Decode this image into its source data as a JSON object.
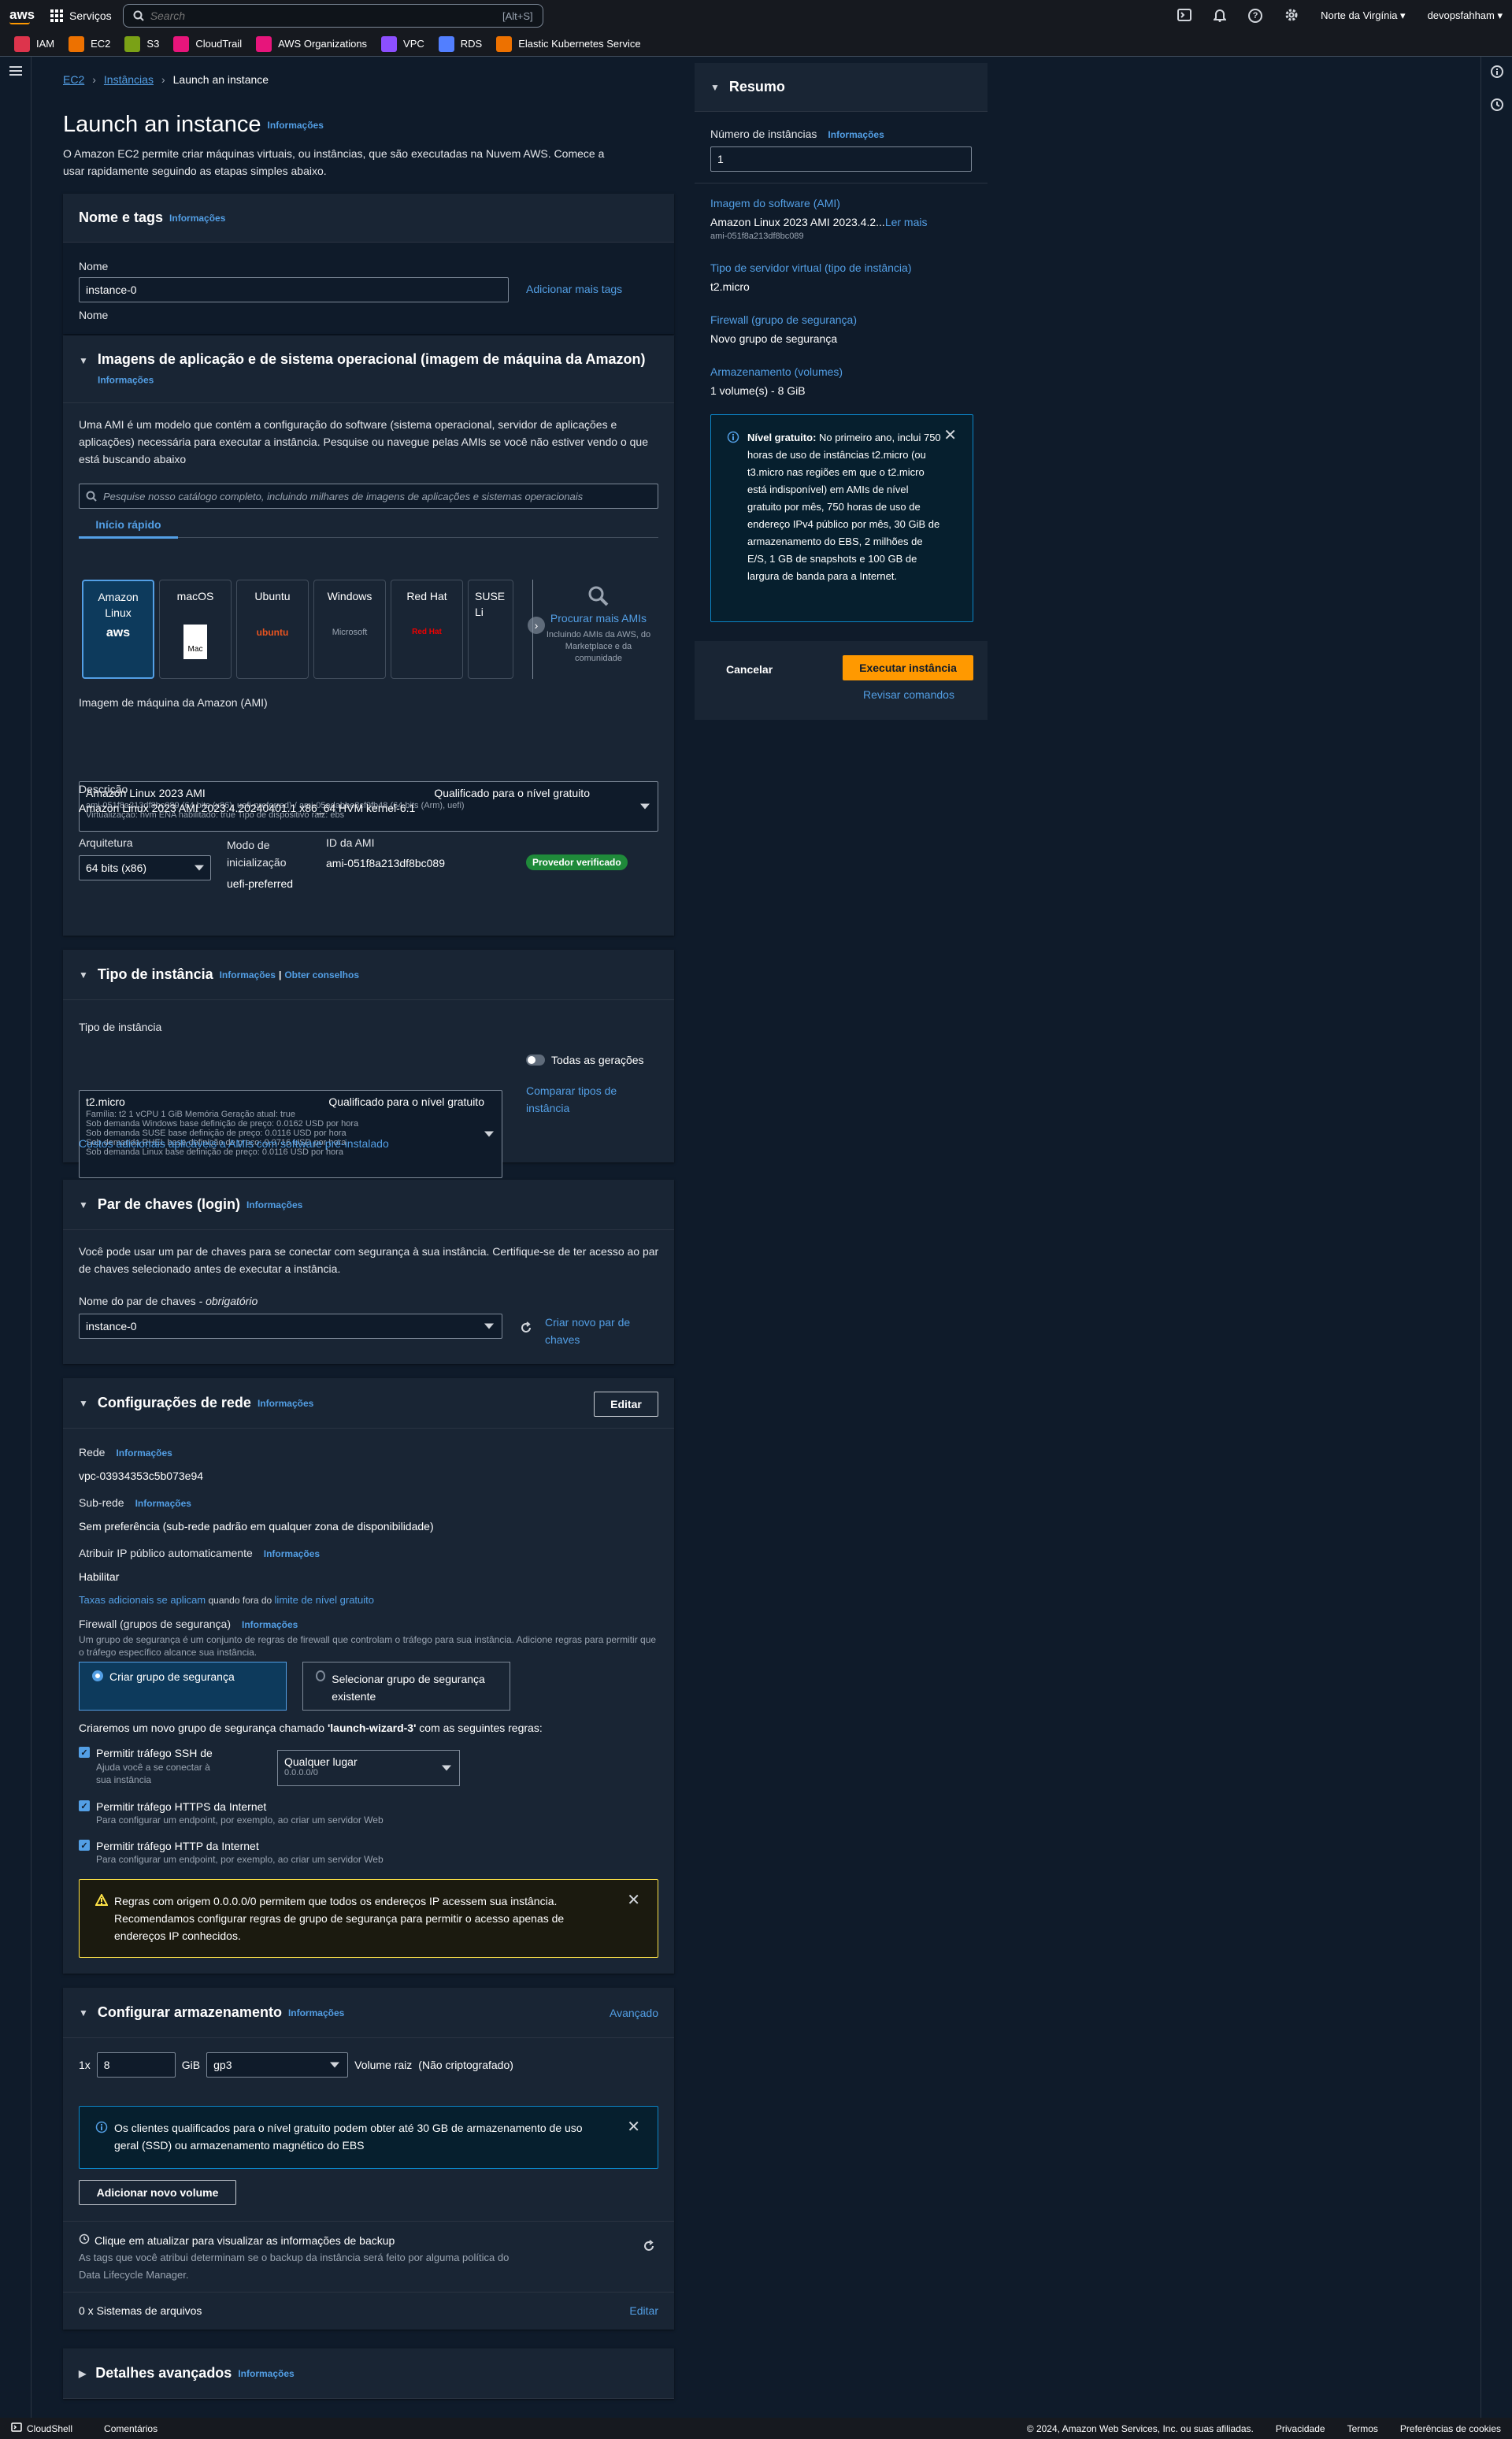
{
  "topnav": {
    "logo": "aws",
    "services_label": "Serviços",
    "search_placeholder": "Search",
    "search_shortcut": "[Alt+S]",
    "region": "Norte da Virgínia ▾",
    "user": "devopsfahham ▾"
  },
  "favorites": [
    {
      "label": "IAM",
      "color": "#dd344c"
    },
    {
      "label": "EC2",
      "color": "#ed7100"
    },
    {
      "label": "S3",
      "color": "#7aa116"
    },
    {
      "label": "CloudTrail",
      "color": "#e7157b"
    },
    {
      "label": "AWS Organizations",
      "color": "#e7157b"
    },
    {
      "label": "VPC",
      "color": "#8c4fff"
    },
    {
      "label": "RDS",
      "color": "#527fff"
    },
    {
      "label": "Elastic Kubernetes Service",
      "color": "#ed7100"
    }
  ],
  "breadcrumb": {
    "ec2": "EC2",
    "instances": "Instâncias",
    "current": "Launch an instance"
  },
  "page": {
    "title": "Launch an instance",
    "info": "Informações",
    "description": "O Amazon EC2 permite criar máquinas virtuais, ou instâncias, que são executadas na Nuvem AWS. Comece a usar rapidamente seguindo as etapas simples abaixo."
  },
  "name_tags": {
    "title": "Nome e tags",
    "info": "Informações",
    "name_label": "Nome",
    "name_value": "instance-0",
    "add_tags": "Adicionar mais tags"
  },
  "ami": {
    "title": "Imagens de aplicação e de sistema operacional (imagem de máquina da Amazon)",
    "info": "Informações",
    "description": "Uma AMI é um modelo que contém a configuração do software (sistema operacional, servidor de aplicações e aplicações) necessária para executar a instância. Pesquise ou navegue pelas AMIs se você não estiver vendo o que está buscando abaixo",
    "search_placeholder": "Pesquise nosso catálogo completo, incluindo milhares de imagens de aplicações e sistemas operacionais",
    "tab": "Início rápido",
    "cards": [
      {
        "line1": "Amazon",
        "line2": "Linux",
        "logo": "aws"
      },
      {
        "line1": "macOS",
        "line2": "",
        "logo": "Mac"
      },
      {
        "line1": "Ubuntu",
        "line2": "",
        "logo": "ubuntu"
      },
      {
        "line1": "Windows",
        "line2": "",
        "logo": "Microsoft"
      },
      {
        "line1": "Red Hat",
        "line2": "",
        "logo": "Red Hat"
      },
      {
        "line1": "SUSE Li",
        "line2": "",
        "logo": ""
      }
    ],
    "browse_more": "Procurar mais AMIs",
    "browse_sub": "Incluindo AMIs da AWS, do Marketplace e da comunidade",
    "select_label": "Imagem de máquina da Amazon (AMI)",
    "select_name": "Amazon Linux 2023 AMI",
    "select_badge": "Qualificado para o nível gratuito",
    "select_line2": "ami-051f8a213df8bc089 (64 bits (x86), uefi-preferred) / ami-05adabbe8cf9fb48 (64 bits (Arm), uefi)",
    "select_line3": "Virtualização: hvm     ENA habilitado: true     Tipo de dispositivo raiz: ebs",
    "desc_label": "Descrição",
    "desc_value": "Amazon Linux 2023 AMI 2023.4.20240401.1 x86_64 HVM kernel-6.1",
    "arch_label": "Arquitetura",
    "arch_value": "64 bits (x86)",
    "boot_label": "Modo de inicialização",
    "boot_value": "uefi-preferred",
    "amiid_label": "ID da AMI",
    "amiid_value": "ami-051f8a213df8bc089",
    "verified": "Provedor verificado"
  },
  "instance_type": {
    "title": "Tipo de instância",
    "info": "Informações",
    "advice": "Obter conselhos",
    "label": "Tipo de instância",
    "name": "t2.micro",
    "badge": "Qualificado para o nível gratuito",
    "line1": "Família: t2     1 vCPU     1 GiB Memória     Geração atual: true",
    "line2": "Sob demanda Windows base definição de preço: 0.0162 USD por hora",
    "line3": "Sob demanda SUSE base definição de preço: 0.0116 USD por hora",
    "line4": "Sob demanda RHEL base definição de preço: 0.0716 USD por hora",
    "line5": "Sob demanda Linux base definição de preço: 0.0116 USD por hora",
    "all_gen": "Todas as gerações",
    "compare": "Comparar tipos de instância",
    "extra": "Custos adicionais aplicáveis a AMIs com software pré-instalado"
  },
  "keypair": {
    "title": "Par de chaves (login)",
    "info": "Informações",
    "description": "Você pode usar um par de chaves para se conectar com segurança à sua instância. Certifique-se de ter acesso ao par de chaves selecionado antes de executar a instância.",
    "label": "Nome do par de chaves",
    "required": " - obrigatório",
    "value": "instance-0",
    "create": "Criar novo par de chaves"
  },
  "network": {
    "title": "Configurações de rede",
    "info": "Informações",
    "edit": "Editar",
    "net_label": "Rede",
    "net_value": "vpc-03934353c5b073e94",
    "subnet_label": "Sub-rede",
    "subnet_value": "Sem preferência (sub-rede padrão em qualquer zona de disponibilidade)",
    "publicip_label": "Atribuir IP público automaticamente",
    "publicip_value": "Habilitar",
    "fees_link": "Taxas adicionais se aplicam",
    "fees_mid": " quando fora do ",
    "fees_link2": "limite de nível gratuito",
    "firewall_label": "Firewall (grupos de segurança)",
    "firewall_desc": "Um grupo de segurança é um conjunto de regras de firewall que controlam o tráfego para sua instância. Adicione regras para permitir que o tráfego específico alcance sua instância.",
    "opt_create": "Criar grupo de segurança",
    "opt_select": "Selecionar grupo de segurança existente",
    "sg_text_pre": "Criaremos um novo grupo de segurança chamado ",
    "sg_name": "'launch-wizard-3'",
    "sg_text_post": " com as seguintes regras:",
    "ssh_label": "Permitir tráfego SSH de",
    "ssh_sub": "Ajuda você a se conectar à sua instância",
    "ssh_source": "Qualquer lugar",
    "ssh_cidr": "0.0.0.0/0",
    "https_label": "Permitir tráfego HTTPS da Internet",
    "https_sub": "Para configurar um endpoint, por exemplo, ao criar um servidor Web",
    "http_label": "Permitir tráfego HTTP da Internet",
    "http_sub": "Para configurar um endpoint, por exemplo, ao criar um servidor Web",
    "warning": "Regras com origem 0.0.0.0/0 permitem que todos os endereços IP acessem sua instância. Recomendamos configurar regras de grupo de segurança para permitir o acesso apenas de endereços IP conhecidos."
  },
  "storage": {
    "title": "Configurar armazenamento",
    "info": "Informações",
    "advanced": "Avançado",
    "count": "1x",
    "size": "8",
    "unit": "GiB",
    "type": "gp3",
    "root": "Volume raiz",
    "encryption": "(Não criptografado)",
    "notice": "Os clientes qualificados para o nível gratuito podem obter até 30 GB de armazenamento de uso geral (SSD) ou armazenamento magnético do EBS",
    "add_volume": "Adicionar novo volume",
    "backup_title": "Clique em atualizar para visualizar as informações de backup",
    "backup_desc": "As tags que você atribui determinam se o backup da instância será feito por alguma política do Data Lifecycle Manager.",
    "fs": "0 x Sistemas de arquivos",
    "fs_edit": "Editar"
  },
  "advanced": {
    "title": "Detalhes avançados",
    "info": "Informações"
  },
  "summary": {
    "title": "Resumo",
    "count_label": "Número de instâncias",
    "info": "Informações",
    "count_value": "1",
    "ami_label": "Imagem do software (AMI)",
    "ami_value": "Amazon Linux 2023 AMI 2023.4.2...",
    "ami_more": "Ler mais",
    "ami_id": "ami-051f8a213df8bc089",
    "type_label": "Tipo de servidor virtual (tipo de instância)",
    "type_value": "t2.micro",
    "fw_label": "Firewall (grupo de segurança)",
    "fw_value": "Novo grupo de segurança",
    "storage_label": "Armazenamento (volumes)",
    "storage_value": "1 volume(s) - 8 GiB",
    "free_bold": "Nível gratuito:",
    "free_text": " No primeiro ano, inclui 750 horas de uso de instâncias t2.micro (ou t3.micro nas regiões em que o t2.micro está indisponível) em AMIs de nível gratuito por mês, 750 horas de uso de endereço IPv4 público por mês, 30 GiB de armazenamento do EBS, 2 milhões de E/S, 1 GB de snapshots e 100 GB de largura de banda para a Internet.",
    "cancel": "Cancelar",
    "launch": "Executar instância",
    "review": "Revisar comandos"
  },
  "footer": {
    "cloudshell": "CloudShell",
    "comments": "Comentários",
    "copyright": "© 2024, Amazon Web Services, Inc. ou suas afiliadas.",
    "privacy": "Privacidade",
    "terms": "Termos",
    "cookies": "Preferências de cookies"
  }
}
